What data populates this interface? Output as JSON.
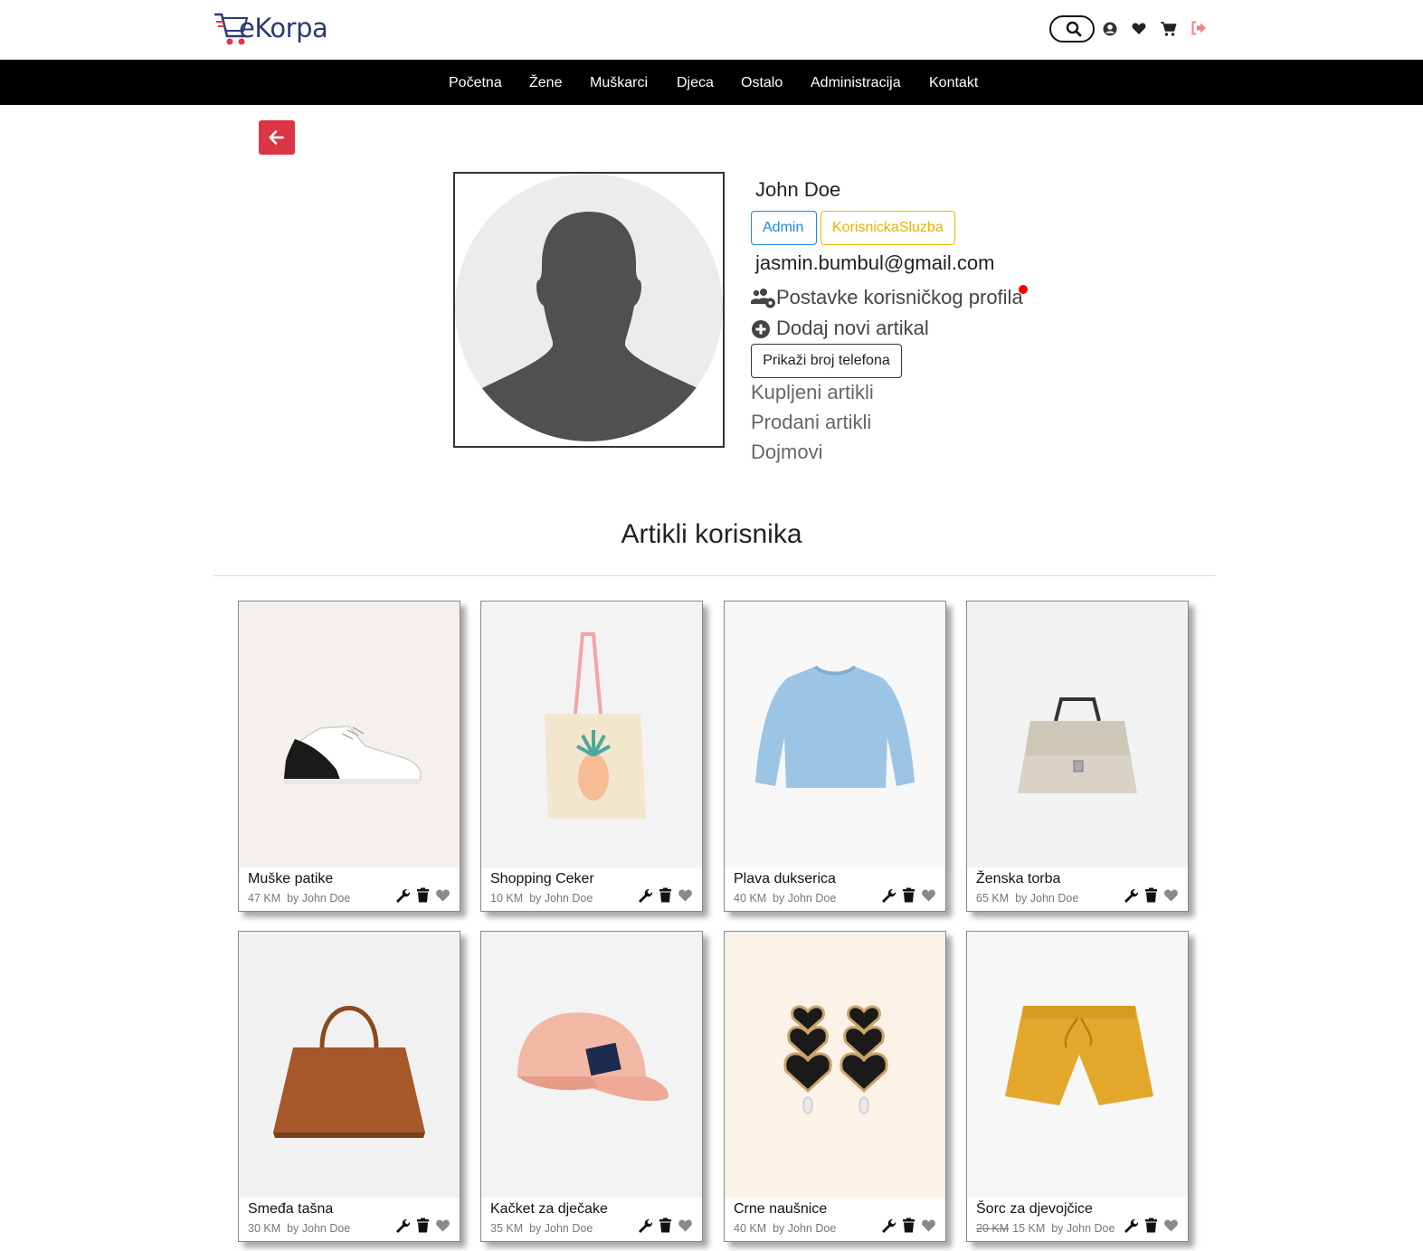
{
  "header": {
    "logo_text": "eKorpa",
    "icons": [
      "search-icon",
      "user-icon",
      "heart-icon",
      "cart-icon",
      "logout-icon"
    ]
  },
  "nav": {
    "items": [
      {
        "label": "Početna"
      },
      {
        "label": "Žene"
      },
      {
        "label": "Muškarci"
      },
      {
        "label": "Djeca"
      },
      {
        "label": "Ostalo"
      },
      {
        "label": "Administracija"
      },
      {
        "label": "Kontakt"
      }
    ]
  },
  "colors": {
    "accent_red": "#dc3545",
    "navbar": "#000000",
    "admin_badge": "#1e88e5",
    "service_badge": "#f5b800"
  },
  "profile": {
    "name": "John Doe",
    "roles": [
      "Admin",
      "KorisnickaSluzba"
    ],
    "email": "jasmin.bumbul@gmail.com",
    "settings_label": "Postavke korisničkog profila",
    "add_item_label": "Dodaj novi artikal",
    "show_phone_label": "Prikaži broj telefona",
    "links": [
      "Kupljeni artikli",
      "Prodani artikli",
      "Dojmovi"
    ]
  },
  "items_section": {
    "title": "Artikli korisnika",
    "items": [
      {
        "title": "Muške patike",
        "price": "47 KM",
        "seller": "by John Doe",
        "old_price": ""
      },
      {
        "title": "Shopping Ceker",
        "price": "10 KM",
        "seller": "by John Doe",
        "old_price": ""
      },
      {
        "title": "Plava dukserica",
        "price": "40 KM",
        "seller": "by John Doe",
        "old_price": ""
      },
      {
        "title": "Ženska torba",
        "price": "65 KM",
        "seller": "by John Doe",
        "old_price": ""
      },
      {
        "title": "Smeđa tašna",
        "price": "30 KM",
        "seller": "by John Doe",
        "old_price": ""
      },
      {
        "title": "Kačket za dječake",
        "price": "35 KM",
        "seller": "by John Doe",
        "old_price": ""
      },
      {
        "title": "Crne naušnice",
        "price": "40 KM",
        "seller": "by John Doe",
        "old_price": ""
      },
      {
        "title": "Šorc za djevojčice",
        "price": "15 KM",
        "seller": "by John Doe",
        "old_price": "20 KM"
      }
    ]
  }
}
